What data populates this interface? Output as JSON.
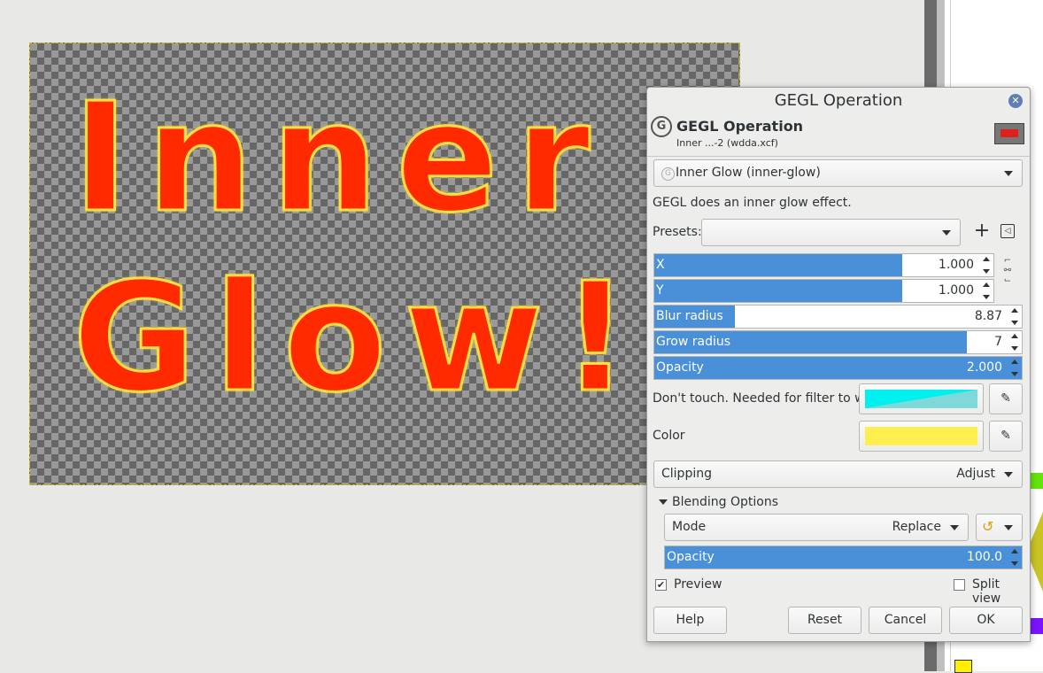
{
  "canvas": {
    "line1": "Inner",
    "line2": "Glow!"
  },
  "dialog": {
    "window_title": "GEGL Operation",
    "header_title": "GEGL Operation",
    "header_subtitle": "Inner ...-2 (wdda.xcf)",
    "operation": "Inner Glow (inner-glow)",
    "description": "GEGL does an inner glow effect.",
    "presets_label": "Presets:",
    "presets_value": "",
    "params": {
      "x": {
        "label": "X",
        "value": "1.000",
        "fraction": 0.73
      },
      "y": {
        "label": "Y",
        "value": "1.000",
        "fraction": 0.73
      },
      "blur": {
        "label": "Blur radius",
        "value": "8.87",
        "fraction": 0.22
      },
      "grow": {
        "label": "Grow radius",
        "value": "7",
        "fraction": 0.85
      },
      "opacity": {
        "label": "Opacity",
        "value": "2.000",
        "fraction": 1.0
      }
    },
    "dont_touch_label": "Don't touch. Needed for filter to work",
    "color_label": "Color",
    "colors": {
      "dont_touch": "#00f0f0",
      "color": "#ffee4f",
      "accent": "#4a90d9"
    },
    "clipping_label": "Clipping",
    "clipping_value": "Adjust",
    "blending_label": "Blending Options",
    "mode_label": "Mode",
    "mode_value": "Replace",
    "blend_opacity": {
      "label": "Opacity",
      "value": "100.0",
      "fraction": 1.0
    },
    "preview_label": "Preview",
    "preview_checked": true,
    "split_view_label": "Split view",
    "split_view_checked": false,
    "buttons": {
      "help": "Help",
      "reset": "Reset",
      "cancel": "Cancel",
      "ok": "OK"
    }
  }
}
